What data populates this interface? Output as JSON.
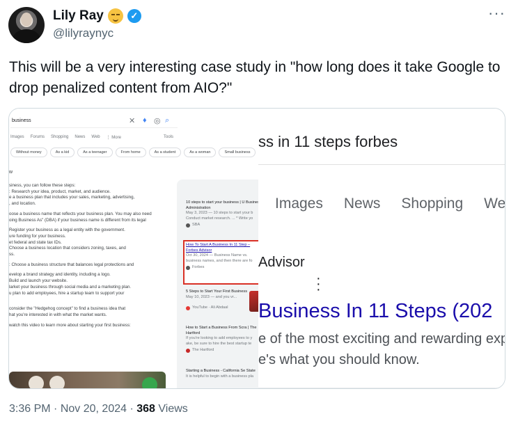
{
  "tweet": {
    "author_name": "Lily Ray",
    "handle": "@lilyraynyc",
    "text": "This will be a very interesting case study in \"how long does it take Google to drop penalized content from AIO?\"",
    "time": "3:36 PM",
    "date": "Nov 20, 2024",
    "views_count": "368",
    "views_label": "Views"
  },
  "left_panel": {
    "query": "business",
    "tabs": [
      "Images",
      "Forums",
      "Shopping",
      "News",
      "Web",
      "⋮ More"
    ],
    "tools": "Tools",
    "chips": [
      "Without money",
      "As a kid",
      "As a teenager",
      "From home",
      "As a student",
      "As a woman",
      "Small business"
    ],
    "answer_prefix": "w",
    "answer_lines": [
      "siness, you can follow these steps:",
      ": Research your idea, product, market, and audience.",
      "e a business plan that includes your sales, marketing, advertising,",
      ", and location.",
      "oose a business name that reflects your business plan. You may also need",
      "oing Business As\" (DBA) if your business name is different from its legal",
      "Register your business as a legal entity with the government.",
      "ure funding for your business.",
      "et federal and state tax IDs.",
      "Choose a business location that considers zoning, taxes, and",
      "ss.",
      ": Choose a business structure that balances legal protections and",
      "evelop a brand strategy and identity, including a logo.",
      "Build and launch your website.",
      "larket your business through social media and a marketing plan.",
      "u plan to add employees, hire a startup team to support your",
      "consider the \"Hedgehog concept\" to find a business idea that",
      "hat you're interested in with what the market wants.",
      "watch this video to learn more about starting your first business:"
    ],
    "sources": [
      {
        "title": "10 steps to start your business | U Business Administration",
        "meta": "May 3, 2023 — 10 steps to start your b",
        "snippet": "Conduct market research. ... * Write yo",
        "site": "SBA"
      },
      {
        "title": "How To Start A Business In 11 Step – Forbes Advisor",
        "meta": "Oct 30, 2024 — Business Name vs.",
        "snippet": "business names, and then there are fo",
        "site": "Forbes"
      },
      {
        "title": "5 Steps to Start Your First Business",
        "meta": "May 10, 2023 — and you vr...",
        "snippet": "",
        "site": "YouTube · Ali Abdaal"
      },
      {
        "title": "How to Start a Business From Scra | The Hartford",
        "meta": "If you're looking to add employees to y",
        "snippet": "ake, be sure to hire the best startup te",
        "site": "The Hartford"
      },
      {
        "title": "Starting a Business - California Se State",
        "meta": "It is helpful to begin with a business pla",
        "snippet": "",
        "site": ""
      }
    ]
  },
  "right_panel": {
    "query_fragment": "ss in 11 steps forbes",
    "tabs": [
      "Images",
      "News",
      "Shopping",
      "Web"
    ],
    "source_fragment": "Advisor",
    "result_title": "Business In 11 Steps (202",
    "snippet_line1": "e of the most exciting and rewarding exp",
    "snippet_line2": "e's what you should know."
  }
}
